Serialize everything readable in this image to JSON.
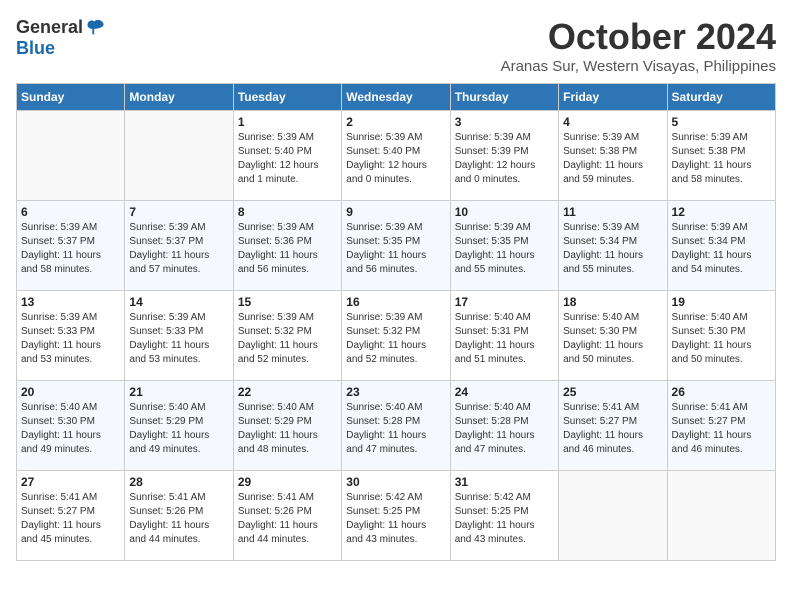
{
  "logo": {
    "general": "General",
    "blue": "Blue"
  },
  "header": {
    "month": "October 2024",
    "location": "Aranas Sur, Western Visayas, Philippines"
  },
  "weekdays": [
    "Sunday",
    "Monday",
    "Tuesday",
    "Wednesday",
    "Thursday",
    "Friday",
    "Saturday"
  ],
  "weeks": [
    [
      {
        "day": "",
        "info": ""
      },
      {
        "day": "",
        "info": ""
      },
      {
        "day": "1",
        "info": "Sunrise: 5:39 AM\nSunset: 5:40 PM\nDaylight: 12 hours\nand 1 minute."
      },
      {
        "day": "2",
        "info": "Sunrise: 5:39 AM\nSunset: 5:40 PM\nDaylight: 12 hours\nand 0 minutes."
      },
      {
        "day": "3",
        "info": "Sunrise: 5:39 AM\nSunset: 5:39 PM\nDaylight: 12 hours\nand 0 minutes."
      },
      {
        "day": "4",
        "info": "Sunrise: 5:39 AM\nSunset: 5:38 PM\nDaylight: 11 hours\nand 59 minutes."
      },
      {
        "day": "5",
        "info": "Sunrise: 5:39 AM\nSunset: 5:38 PM\nDaylight: 11 hours\nand 58 minutes."
      }
    ],
    [
      {
        "day": "6",
        "info": "Sunrise: 5:39 AM\nSunset: 5:37 PM\nDaylight: 11 hours\nand 58 minutes."
      },
      {
        "day": "7",
        "info": "Sunrise: 5:39 AM\nSunset: 5:37 PM\nDaylight: 11 hours\nand 57 minutes."
      },
      {
        "day": "8",
        "info": "Sunrise: 5:39 AM\nSunset: 5:36 PM\nDaylight: 11 hours\nand 56 minutes."
      },
      {
        "day": "9",
        "info": "Sunrise: 5:39 AM\nSunset: 5:35 PM\nDaylight: 11 hours\nand 56 minutes."
      },
      {
        "day": "10",
        "info": "Sunrise: 5:39 AM\nSunset: 5:35 PM\nDaylight: 11 hours\nand 55 minutes."
      },
      {
        "day": "11",
        "info": "Sunrise: 5:39 AM\nSunset: 5:34 PM\nDaylight: 11 hours\nand 55 minutes."
      },
      {
        "day": "12",
        "info": "Sunrise: 5:39 AM\nSunset: 5:34 PM\nDaylight: 11 hours\nand 54 minutes."
      }
    ],
    [
      {
        "day": "13",
        "info": "Sunrise: 5:39 AM\nSunset: 5:33 PM\nDaylight: 11 hours\nand 53 minutes."
      },
      {
        "day": "14",
        "info": "Sunrise: 5:39 AM\nSunset: 5:33 PM\nDaylight: 11 hours\nand 53 minutes."
      },
      {
        "day": "15",
        "info": "Sunrise: 5:39 AM\nSunset: 5:32 PM\nDaylight: 11 hours\nand 52 minutes."
      },
      {
        "day": "16",
        "info": "Sunrise: 5:39 AM\nSunset: 5:32 PM\nDaylight: 11 hours\nand 52 minutes."
      },
      {
        "day": "17",
        "info": "Sunrise: 5:40 AM\nSunset: 5:31 PM\nDaylight: 11 hours\nand 51 minutes."
      },
      {
        "day": "18",
        "info": "Sunrise: 5:40 AM\nSunset: 5:30 PM\nDaylight: 11 hours\nand 50 minutes."
      },
      {
        "day": "19",
        "info": "Sunrise: 5:40 AM\nSunset: 5:30 PM\nDaylight: 11 hours\nand 50 minutes."
      }
    ],
    [
      {
        "day": "20",
        "info": "Sunrise: 5:40 AM\nSunset: 5:30 PM\nDaylight: 11 hours\nand 49 minutes."
      },
      {
        "day": "21",
        "info": "Sunrise: 5:40 AM\nSunset: 5:29 PM\nDaylight: 11 hours\nand 49 minutes."
      },
      {
        "day": "22",
        "info": "Sunrise: 5:40 AM\nSunset: 5:29 PM\nDaylight: 11 hours\nand 48 minutes."
      },
      {
        "day": "23",
        "info": "Sunrise: 5:40 AM\nSunset: 5:28 PM\nDaylight: 11 hours\nand 47 minutes."
      },
      {
        "day": "24",
        "info": "Sunrise: 5:40 AM\nSunset: 5:28 PM\nDaylight: 11 hours\nand 47 minutes."
      },
      {
        "day": "25",
        "info": "Sunrise: 5:41 AM\nSunset: 5:27 PM\nDaylight: 11 hours\nand 46 minutes."
      },
      {
        "day": "26",
        "info": "Sunrise: 5:41 AM\nSunset: 5:27 PM\nDaylight: 11 hours\nand 46 minutes."
      }
    ],
    [
      {
        "day": "27",
        "info": "Sunrise: 5:41 AM\nSunset: 5:27 PM\nDaylight: 11 hours\nand 45 minutes."
      },
      {
        "day": "28",
        "info": "Sunrise: 5:41 AM\nSunset: 5:26 PM\nDaylight: 11 hours\nand 44 minutes."
      },
      {
        "day": "29",
        "info": "Sunrise: 5:41 AM\nSunset: 5:26 PM\nDaylight: 11 hours\nand 44 minutes."
      },
      {
        "day": "30",
        "info": "Sunrise: 5:42 AM\nSunset: 5:25 PM\nDaylight: 11 hours\nand 43 minutes."
      },
      {
        "day": "31",
        "info": "Sunrise: 5:42 AM\nSunset: 5:25 PM\nDaylight: 11 hours\nand 43 minutes."
      },
      {
        "day": "",
        "info": ""
      },
      {
        "day": "",
        "info": ""
      }
    ]
  ]
}
